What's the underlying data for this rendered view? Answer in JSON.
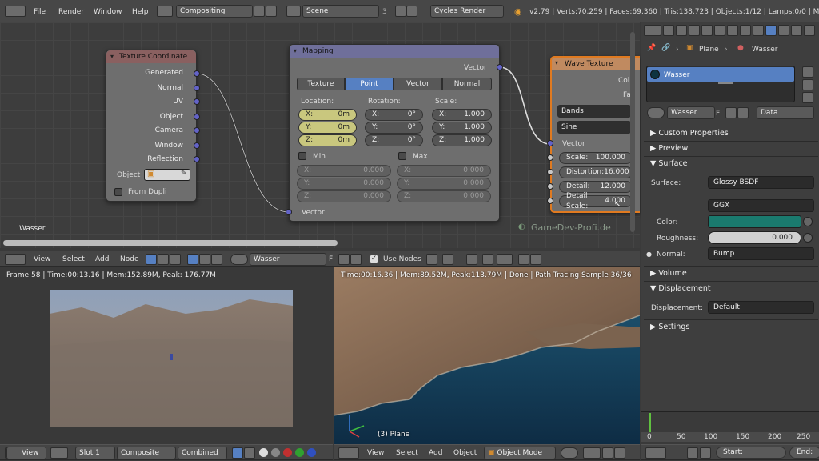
{
  "topbar": {
    "menus": [
      "File",
      "Render",
      "Window",
      "Help"
    ],
    "layout": "Compositing",
    "scene": "Scene",
    "scene_num": "3",
    "engine": "Cycles Render",
    "stats": "v2.79 | Verts:70,259 | Faces:69,360 | Tris:138,723 | Objects:1/12 | Lamps:0/0 | Mem:306"
  },
  "node_editor": {
    "material_label": "Wasser",
    "watermark": "GameDev-Profi.de",
    "texcoord": {
      "title": "Texture Coordinate",
      "outputs": [
        "Generated",
        "Normal",
        "UV",
        "Object",
        "Camera",
        "Window",
        "Reflection"
      ],
      "object_label": "Object",
      "from_dupli": "From Dupli"
    },
    "mapping": {
      "title": "Mapping",
      "out": "Vector",
      "tabs": [
        "Texture",
        "Point",
        "Vector",
        "Normal"
      ],
      "location_label": "Location:",
      "rotation_label": "Rotation:",
      "scale_label": "Scale:",
      "loc": [
        "X:",
        "0m",
        "Y:",
        "0m",
        "Z:",
        "0m"
      ],
      "rot": [
        "X:",
        "0°",
        "Y:",
        "0°",
        "Z:",
        "0°"
      ],
      "scl": [
        "X:",
        "1.000",
        "Y:",
        "1.000",
        "Z:",
        "1.000"
      ],
      "min_label": "Min",
      "max_label": "Max",
      "min": [
        "X:",
        "0.000",
        "Y:",
        "0.000",
        "Z:",
        "0.000"
      ],
      "max": [
        "X:",
        "0.000",
        "Y:",
        "0.000",
        "Z:",
        "0.000"
      ],
      "in": "Vector"
    },
    "wave": {
      "title": "Wave Texture",
      "out1": "Col",
      "out2": "Fa",
      "type": "Bands",
      "profile": "Sine",
      "vector": "Vector",
      "scale_label": "Scale:",
      "scale_val": "100.000",
      "distortion_label": "Distortion:",
      "distortion_val": "16.000",
      "detail_label": "Detail:",
      "detail_val": "12.000",
      "detail_scale_label": "Detail Scale:",
      "detail_scale_val": "4.000"
    }
  },
  "node_header": {
    "items": [
      "View",
      "Select",
      "Add",
      "Node"
    ],
    "material": "Wasser",
    "use_nodes": "Use Nodes"
  },
  "image_editor": {
    "info": "Frame:58 | Time:00:13.16 | Mem:152.89M, Peak: 176.77M",
    "view": "View",
    "slot": "Slot 1",
    "composite": "Composite",
    "combined": "Combined"
  },
  "viewport": {
    "info": "Time:00:16.36 | Mem:89.52M, Peak:113.79M | Done | Path Tracing Sample 36/36",
    "label": "(3) Plane",
    "menus": [
      "View",
      "Select",
      "Add",
      "Object"
    ],
    "mode": "Object Mode"
  },
  "properties": {
    "breadcrumb_obj": "Plane",
    "breadcrumb_mat": "Wasser",
    "slot_name": "Wasser",
    "material_field": "Wasser",
    "f_label": "F",
    "data_label": "Data",
    "sections": {
      "custom": "Custom Properties",
      "preview": "Preview",
      "surface": "Surface",
      "volume": "Volume",
      "displacement": "Displacement",
      "settings": "Settings"
    },
    "surface_label": "Surface:",
    "surface_val": "Glossy BSDF",
    "dist_val": "GGX",
    "color_label": "Color:",
    "color_hex": "#1a7a6e",
    "roughness_label": "Roughness:",
    "roughness_val": "0.000",
    "normal_label": "Normal:",
    "normal_val": "Bump",
    "displacement_label": "Displacement:",
    "displacement_val": "Default"
  },
  "timeline": {
    "ticks": [
      "0",
      "50",
      "100",
      "150",
      "200",
      "250"
    ],
    "start": "Start:",
    "end": "End:"
  }
}
